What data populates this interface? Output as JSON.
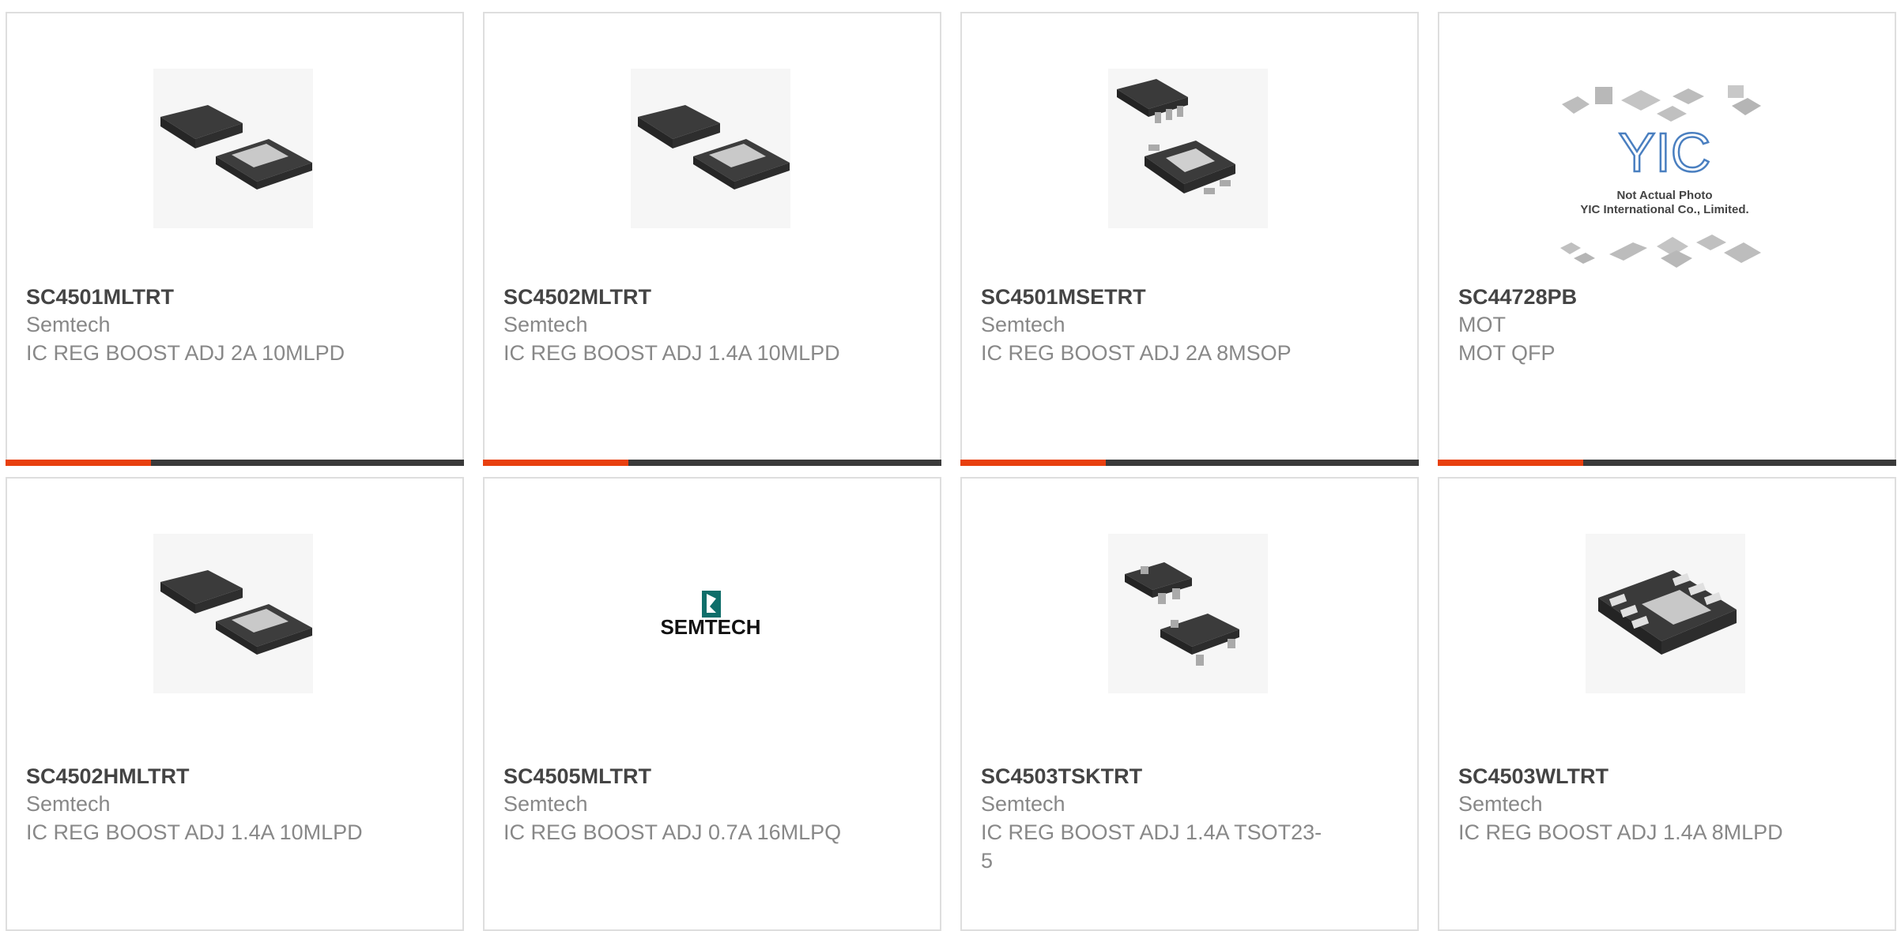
{
  "colors": {
    "accent": "#e8400f",
    "bar_dark": "#3a3a3a",
    "border": "#dedede"
  },
  "products": [
    {
      "part_number": "SC4501MLTRT",
      "manufacturer": "Semtech",
      "description": "IC REG BOOST ADJ 2A 10MLPD",
      "image": "ic-package-mlpd-icon"
    },
    {
      "part_number": "SC4502MLTRT",
      "manufacturer": "Semtech",
      "description": "IC REG BOOST ADJ 1.4A 10MLPD",
      "image": "ic-package-mlpd-icon"
    },
    {
      "part_number": "SC4501MSETRT",
      "manufacturer": "Semtech",
      "description": "IC REG BOOST ADJ 2A 8MSOP",
      "image": "ic-package-msop-icon"
    },
    {
      "part_number": "SC44728PB",
      "manufacturer": "MOT",
      "description": "MOT QFP",
      "image": "not-actual-photo-placeholder",
      "image_text": {
        "logo": "YIC",
        "line1": "Not Actual Photo",
        "line2": "YIC International Co., Limited."
      }
    },
    {
      "part_number": "SC4502HMLTRT",
      "manufacturer": "Semtech",
      "description": "IC REG BOOST ADJ 1.4A 10MLPD",
      "image": "ic-package-mlpd-icon"
    },
    {
      "part_number": "SC4505MLTRT",
      "manufacturer": "Semtech",
      "description": "IC REG BOOST ADJ 0.7A 16MLPQ",
      "image": "semtech-logo",
      "image_text": {
        "logo": "SEMTECH"
      }
    },
    {
      "part_number": "SC4503TSKTRT",
      "manufacturer": "Semtech",
      "description": "IC REG BOOST ADJ 1.4A TSOT23-5",
      "image": "ic-package-tsot-icon"
    },
    {
      "part_number": "SC4503WLTRT",
      "manufacturer": "Semtech",
      "description": "IC REG BOOST ADJ 1.4A 8MLPD",
      "image": "ic-package-dfn-icon"
    }
  ]
}
